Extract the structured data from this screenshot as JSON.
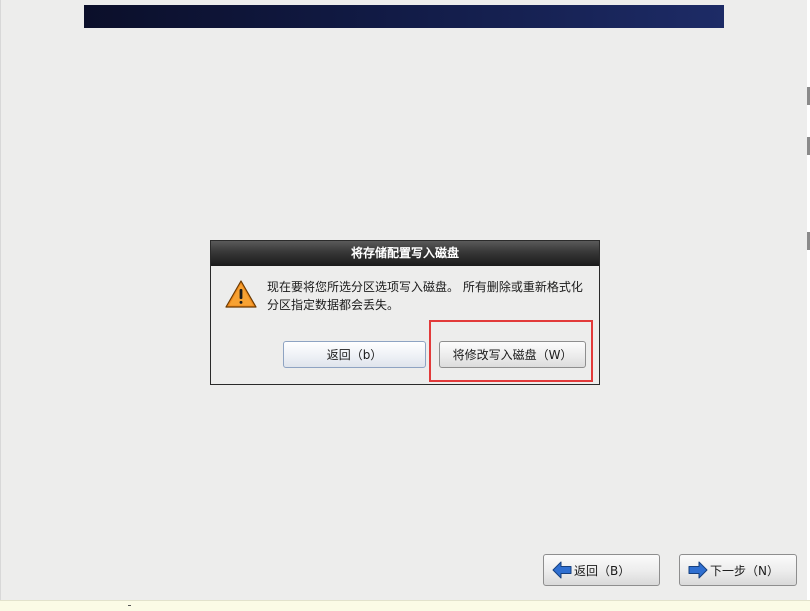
{
  "dialog": {
    "title": "将存储配置写入磁盘",
    "message": "现在要将您所选分区选项写入磁盘。 所有删除或重新格式化分区指定数据都会丢失。",
    "back_label": "返回（b）",
    "write_label": "将修改写入磁盘（W）",
    "icon": "warning-icon"
  },
  "nav": {
    "back_label": "返回（B）",
    "next_label": "下一步（N）",
    "back_icon": "arrow-left-icon",
    "next_icon": "arrow-right-icon"
  },
  "colors": {
    "highlight": "#e23a3a",
    "warning": "#f08a1c",
    "arrow": "#2f6fd1",
    "banner": "#0b0f2a"
  }
}
